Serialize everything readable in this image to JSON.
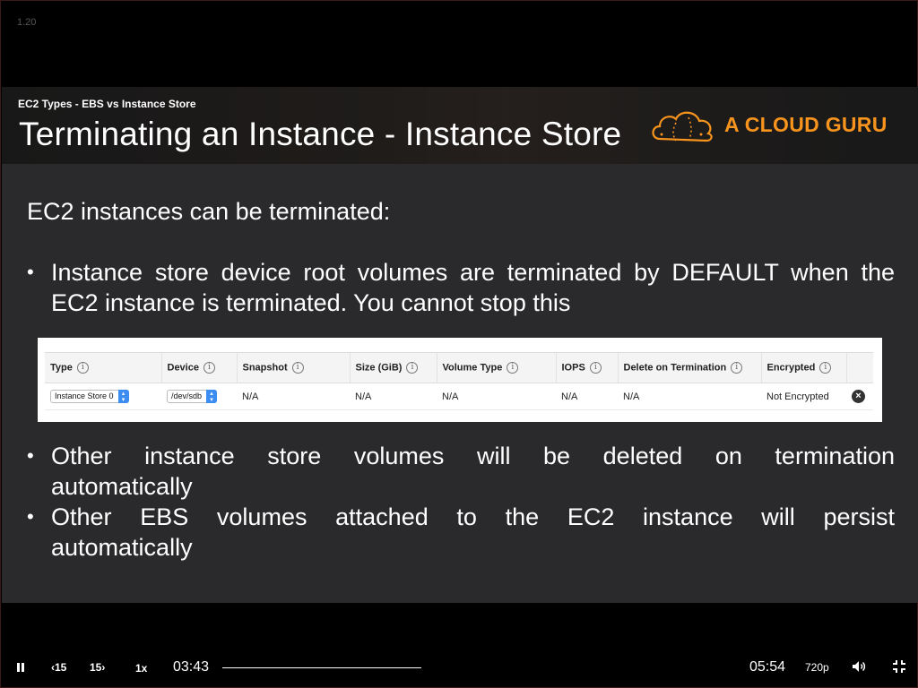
{
  "player": {
    "version": "1.20",
    "current_time": "03:43",
    "duration": "05:54",
    "quality": "720p",
    "speed": "1x",
    "rewind_label": "15",
    "forward_label": "15",
    "progress": 0.63
  },
  "slide": {
    "kicker": "EC2 Types - EBS vs Instance Store",
    "title": "Terminating an Instance - Instance Store",
    "logo_text": "A CLOUD GURU",
    "intro": "EC2 instances can be terminated:",
    "bullet_symbol": "•",
    "bullets": [
      "Instance store device root volumes are terminated by DEFAULT when the EC2 instance is terminated. You cannot stop this",
      "Other instance store volumes will be deleted on termination automatically",
      "Other EBS volumes attached to the EC2 instance will persist automatically"
    ],
    "bullet_lines": {
      "b1_line1": "Instance store device root volumes are terminated by DEFAULT when the",
      "b1_line2": "EC2 instance is terminated. You cannot stop this",
      "b2_line1": "Other instance store volumes will be deleted on termination",
      "b2_line2": "automatically",
      "b3_line1": "Other EBS volumes attached to the EC2 instance will persist",
      "b3_line2": "automatically"
    }
  },
  "volume_table": {
    "columns": [
      "Type",
      "Device",
      "Snapshot",
      "Size (GiB)",
      "Volume Type",
      "IOPS",
      "Delete on Termination",
      "Encrypted"
    ],
    "info_glyph": "i",
    "row": {
      "type": "Instance Store 0",
      "device": "/dev/sdb",
      "snapshot": "N/A",
      "size": "N/A",
      "volume_type": "N/A",
      "iops": "N/A",
      "delete_on_termination": "N/A",
      "encrypted": "Not Encrypted"
    }
  },
  "colors": {
    "brand_orange": "#f7941d",
    "slide_bg": "#2a2a2c",
    "select_blue": "#3b8df2"
  },
  "icons": {
    "play_pause": "pause-icon",
    "rewind": "rewind-15-icon",
    "forward": "forward-15-icon",
    "volume": "speaker-icon",
    "exit_fullscreen": "exit-fullscreen-icon",
    "remove": "close-circle-icon",
    "logo": "cloud-logo-icon"
  }
}
